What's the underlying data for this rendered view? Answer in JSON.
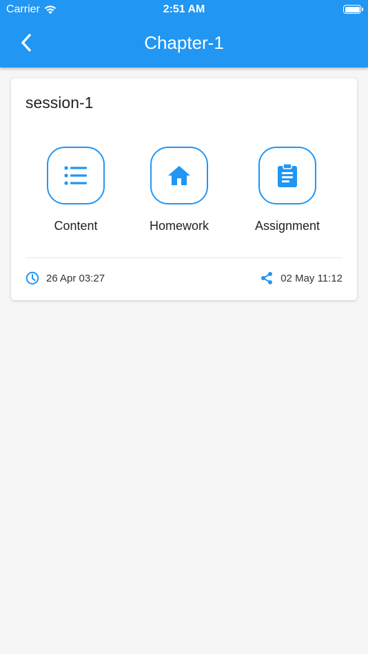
{
  "status_bar": {
    "carrier": "Carrier",
    "time": "2:51 AM"
  },
  "header": {
    "title": "Chapter-1",
    "back_icon": "chevron-left-icon"
  },
  "session_card": {
    "title": "session-1",
    "actions": [
      {
        "label": "Content",
        "icon": "list-icon"
      },
      {
        "label": "Homework",
        "icon": "home-icon"
      },
      {
        "label": "Assignment",
        "icon": "clipboard-icon"
      }
    ],
    "created_time": "26 Apr 03:27",
    "shared_time": "02 May 11:12"
  },
  "colors": {
    "primary": "#2196f3",
    "background": "#f6f6f6",
    "card": "#ffffff"
  }
}
